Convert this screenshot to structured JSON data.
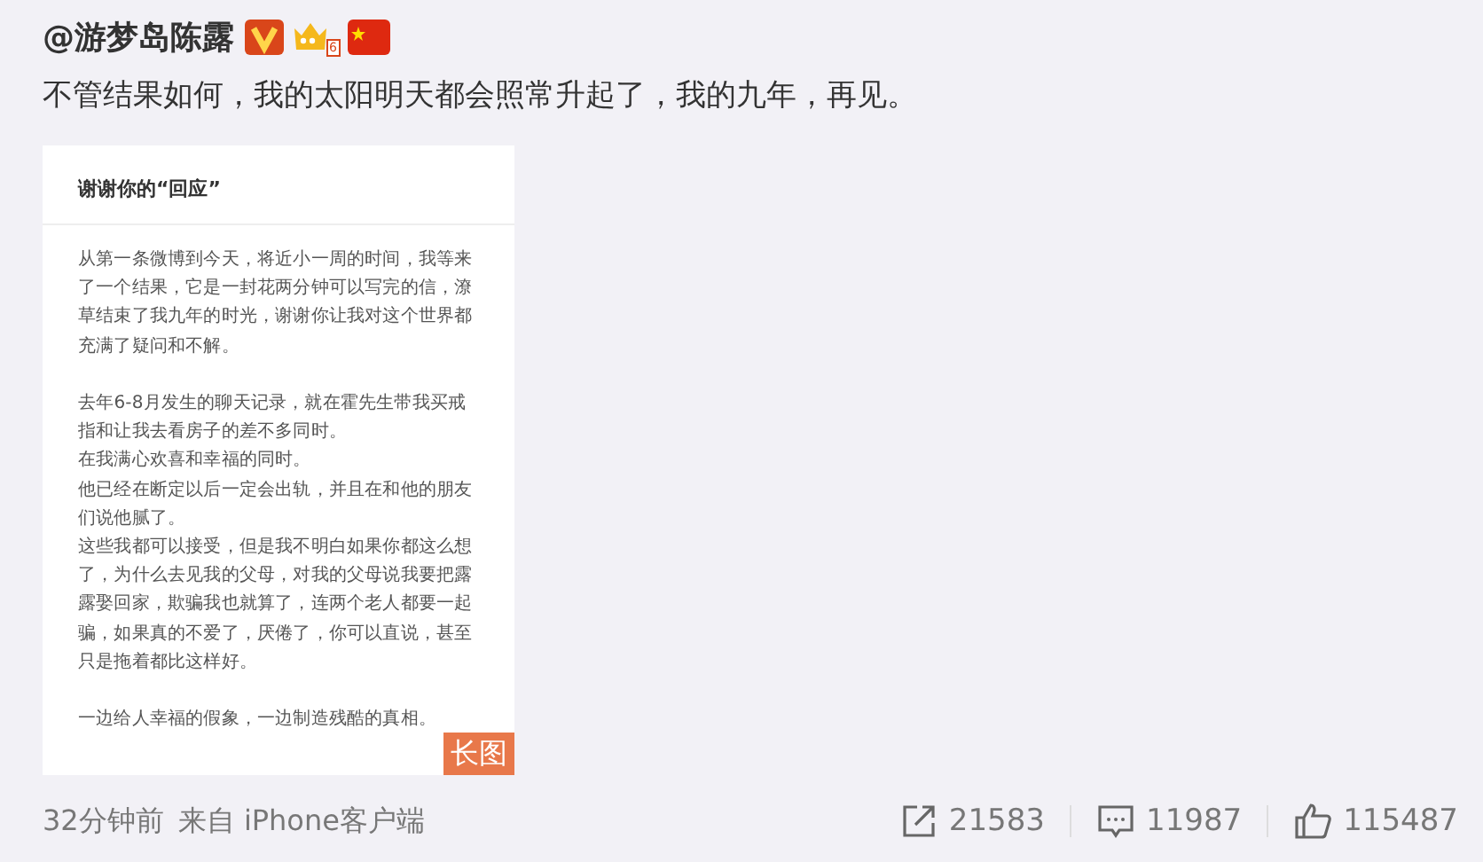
{
  "post": {
    "author": "@游梦岛陈露",
    "level": "6",
    "text": "不管结果如何，我的太阳明天都会照常升起了，我的九年，再见。",
    "image": {
      "title": "谢谢你的“回应”",
      "badge": "长图",
      "paragraphs": [
        [
          "从第一条微博到今天，将近小一周的时间，我等来了一个结果，它是一封花两分钟可以写完的信，潦草结束了我九年的时光，谢谢你让我对这个世界都充满了疑问和不解。"
        ],
        [
          "去年6-8月发生的聊天记录，就在霍先生带我买戒指和让我去看房子的差不多同时。",
          "在我满心欢喜和幸福的同时。",
          "他已经在断定以后一定会出轨，并且在和他的朋友们说他腻了。",
          "这些我都可以接受，但是我不明白如果你都这么想了，为什么去见我的父母，对我的父母说我要把露露娶回家，欺骗我也就算了，连两个老人都要一起骗，如果真的不爱了，厌倦了，你可以直说，甚至只是拖着都比这样好。"
        ],
        [
          "一边给人幸福的假象，一边制造残酷的真相。"
        ]
      ]
    },
    "time": "32分钟前",
    "source": "来自 iPhone客户端",
    "actions": [
      {
        "kind": "repost",
        "count": "21583"
      },
      {
        "kind": "comment",
        "count": "11987"
      },
      {
        "kind": "like",
        "count": "115487"
      }
    ]
  }
}
